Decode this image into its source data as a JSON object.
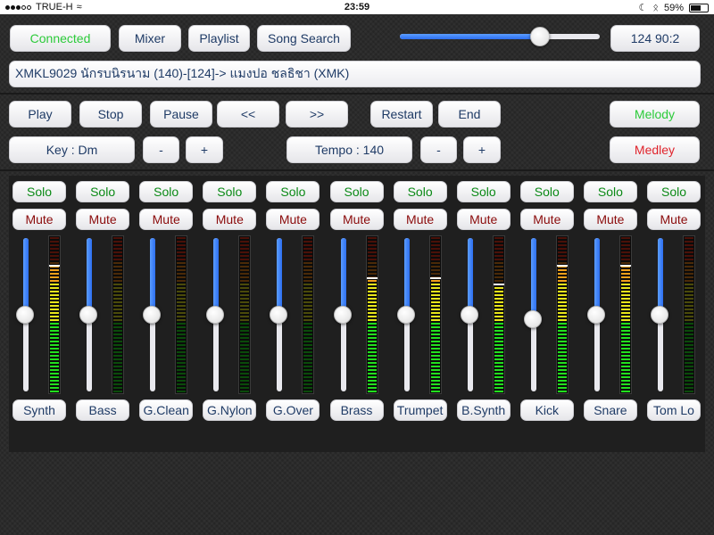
{
  "status_bar": {
    "carrier": "TRUE-H",
    "time": "23:59",
    "battery": "59%",
    "battery_level": 0.59
  },
  "toolbar": {
    "connected_label": "Connected",
    "mixer_label": "Mixer",
    "playlist_label": "Playlist",
    "song_search_label": "Song Search",
    "volume_level": 0.7,
    "counter_display": "124  90:2"
  },
  "song_info": "XMKL9029 นักรบนิรนาม (140)-[124]-> แมงปอ ชลธิชา (XMK)",
  "transport": {
    "play": "Play",
    "stop": "Stop",
    "pause": "Pause",
    "rewind": "<<",
    "forward": ">>",
    "restart": "Restart",
    "end": "End",
    "melody": "Melody",
    "medley": "Medley"
  },
  "key_control": {
    "label": "Key : Dm",
    "minus": "-",
    "plus": "+"
  },
  "tempo_control": {
    "label": "Tempo : 140",
    "minus": "-",
    "plus": "+"
  },
  "colors": {
    "connected": "#2ccb3a",
    "melody": "#2ccb3a",
    "medley": "#e0242c",
    "solo": "#0b8a16",
    "mute": "#8b0b0b",
    "text_blue": "#1f3b66"
  },
  "mixer": {
    "solo_label": "Solo",
    "mute_label": "Mute",
    "channels": [
      {
        "name": "Synth",
        "fader": 0.5,
        "peak": 0.82
      },
      {
        "name": "Bass",
        "fader": 0.5,
        "peak": 0.0
      },
      {
        "name": "G.Clean",
        "fader": 0.5,
        "peak": 0.0
      },
      {
        "name": "G.Nylon",
        "fader": 0.5,
        "peak": 0.0
      },
      {
        "name": "G.Over",
        "fader": 0.5,
        "peak": 0.0
      },
      {
        "name": "Brass",
        "fader": 0.5,
        "peak": 0.74
      },
      {
        "name": "Trumpet",
        "fader": 0.5,
        "peak": 0.74
      },
      {
        "name": "B.Synth",
        "fader": 0.5,
        "peak": 0.7
      },
      {
        "name": "Kick",
        "fader": 0.47,
        "peak": 0.82
      },
      {
        "name": "Snare",
        "fader": 0.5,
        "peak": 0.82
      },
      {
        "name": "Tom Lo",
        "fader": 0.5,
        "peak": 0.0
      }
    ]
  }
}
